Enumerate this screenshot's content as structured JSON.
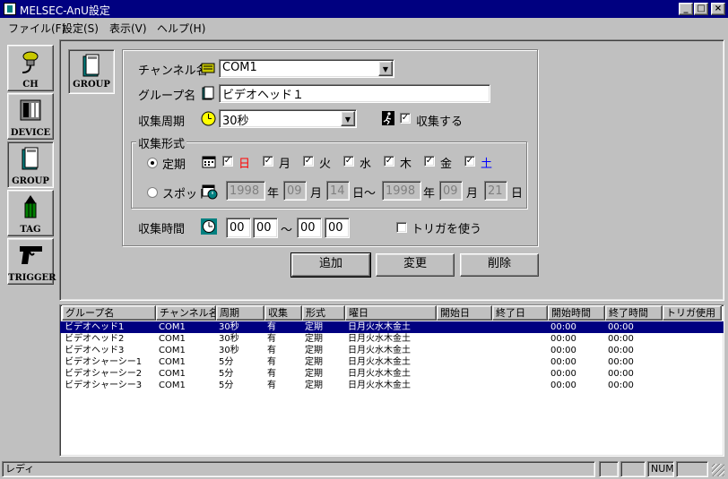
{
  "window": {
    "title": "MELSEC-AnU設定"
  },
  "menu": [
    "ファイル(F)",
    "設定(S)",
    "表示(V)",
    "ヘルプ(H)"
  ],
  "toolbar": {
    "ch": "CH",
    "device": "DEVICE",
    "group": "GROUP",
    "tag": "TAG",
    "trigger": "TRIGGER"
  },
  "panel": {
    "group_label": "GROUP"
  },
  "form": {
    "channel_label": "チャンネル名",
    "channel_value": "COM1",
    "group_label": "グループ名",
    "group_value": "ビデオヘッド１",
    "period_label": "収集周期",
    "period_value": "30秒",
    "collect_label": "収集する",
    "format_label": "収集形式",
    "periodic_label": "定期",
    "days": [
      "日",
      "月",
      "火",
      "水",
      "木",
      "金",
      "土"
    ],
    "spot_label": "スポット",
    "start_year": "1998",
    "year_unit": "年",
    "start_month": "09",
    "month_unit": "月",
    "start_day": "14",
    "day_unit": "日～",
    "end_year": "1998",
    "end_year_unit": "年",
    "end_month": "09",
    "end_month_unit": "月",
    "end_day": "21",
    "end_day_unit": "日",
    "time_label": "収集時間",
    "start_hour": "00",
    "start_min": "00",
    "tilde": "～",
    "end_hour": "00",
    "end_min": "00",
    "trigger_label": "トリガを使う",
    "add_button": "追加",
    "change_button": "変更",
    "delete_button": "削除"
  },
  "colors": {
    "sunday": "#ff0000",
    "saturday": "#0000ff",
    "selection": "#000080"
  },
  "table": {
    "columns": [
      "グループ名",
      "チャンネル名",
      "周期",
      "収集",
      "形式",
      "曜日",
      "開始日",
      "終了日",
      "開始時間",
      "終了時間",
      "トリガ使用"
    ],
    "rows": [
      [
        "ビデオヘッド1",
        "COM1",
        "30秒",
        "有",
        "定期",
        "日月火水木金土",
        "",
        "",
        "00:00",
        "00:00",
        ""
      ],
      [
        "ビデオヘッド2",
        "COM1",
        "30秒",
        "有",
        "定期",
        "日月火水木金土",
        "",
        "",
        "00:00",
        "00:00",
        ""
      ],
      [
        "ビデオヘッド3",
        "COM1",
        "30秒",
        "有",
        "定期",
        "日月火水木金土",
        "",
        "",
        "00:00",
        "00:00",
        ""
      ],
      [
        "ビデオシャーシー1",
        "COM1",
        "5分",
        "有",
        "定期",
        "日月火水木金土",
        "",
        "",
        "00:00",
        "00:00",
        ""
      ],
      [
        "ビデオシャーシー2",
        "COM1",
        "5分",
        "有",
        "定期",
        "日月火水木金土",
        "",
        "",
        "00:00",
        "00:00",
        ""
      ],
      [
        "ビデオシャーシー3",
        "COM1",
        "5分",
        "有",
        "定期",
        "日月火水木金土",
        "",
        "",
        "00:00",
        "00:00",
        ""
      ]
    ]
  },
  "status": {
    "text": "レディ",
    "num": "NUM"
  }
}
